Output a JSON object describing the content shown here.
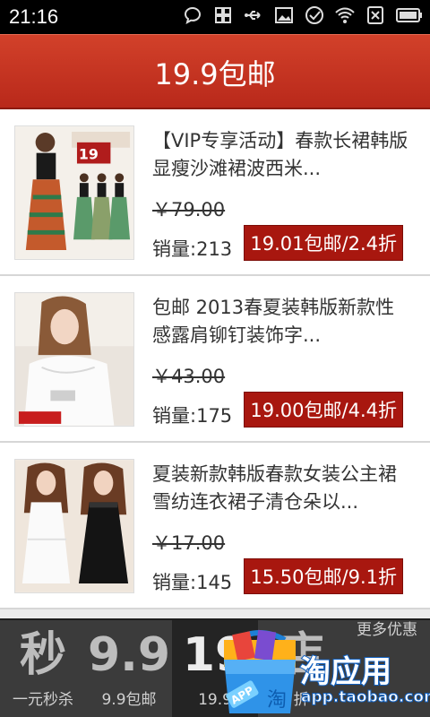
{
  "status_bar": {
    "time": "21:16",
    "icons": [
      "chat-bubble-icon",
      "grid-icon",
      "usb-icon",
      "image-icon",
      "check-circle-icon",
      "wifi-icon",
      "no-sim-icon",
      "battery-icon"
    ]
  },
  "header": {
    "title": "19.9包邮"
  },
  "products": [
    {
      "title": "【VIP专享活动】春款长裙韩版显瘦沙滩裙波西米...",
      "old_price": "￥79.00",
      "sales_label": "销量:",
      "sales_value": "213",
      "deal": "19.01包邮/2.4折",
      "image": "dress-models-photo"
    },
    {
      "title": "包邮 2013春夏装韩版新款性感露肩铆钉装饰字...",
      "old_price": "￥43.00",
      "sales_label": "销量:",
      "sales_value": "175",
      "deal": "19.00包邮/4.4折",
      "image": "white-top-model-photo"
    },
    {
      "title": "夏装新款韩版春款女装公主裙雪纺连衣裙子清仓朵以...",
      "old_price": "￥17.00",
      "sales_label": "销量:",
      "sales_value": "145",
      "deal": "15.50包邮/9.1折",
      "image": "chiffon-dress-photo"
    }
  ],
  "bottom_tabs": [
    {
      "big": "秒",
      "small": "一元秒杀"
    },
    {
      "big": "9.9",
      "small": "9.9包邮"
    },
    {
      "big": "19",
      "small": "19.9"
    },
    {
      "big": "店",
      "small": "折"
    },
    {
      "big": "",
      "small": "更多优惠"
    }
  ],
  "store_overlay": {
    "name": "淘应用",
    "url": "app.taobao.com",
    "badge": "APP",
    "bag_letter": "淘"
  },
  "colors": {
    "header_red": "#c0321f",
    "deal_red": "#a8170f",
    "bottom_bar": "#3b3b3b",
    "store_blue": "#0f5fbf"
  }
}
